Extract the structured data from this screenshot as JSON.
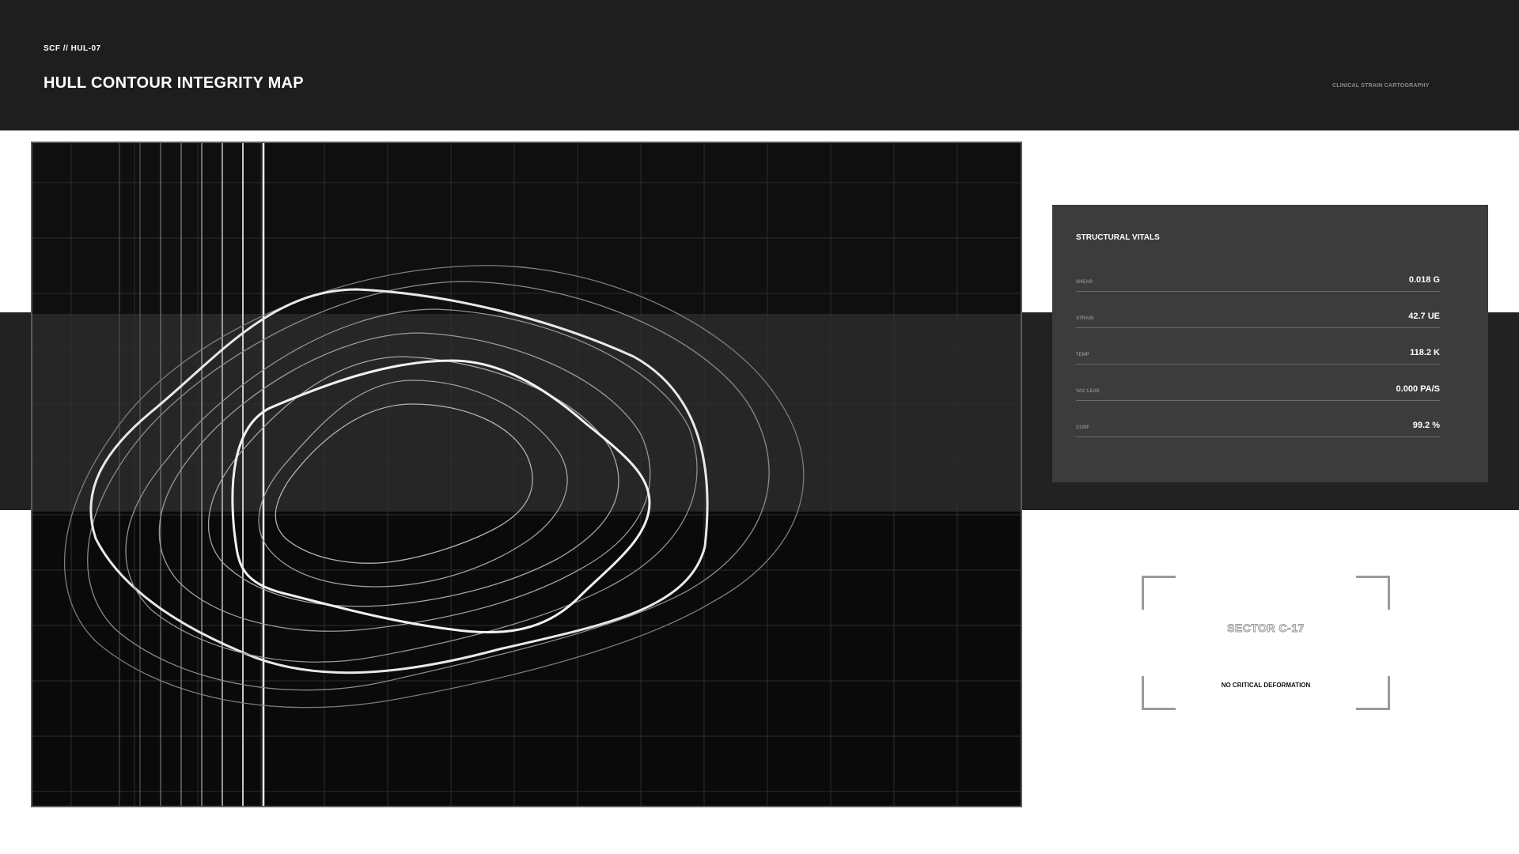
{
  "header": {
    "code": "SCF // HUL-07",
    "title": "HULL CONTOUR INTEGRITY MAP",
    "tag": "CLINICAL STRAIN CARTOGRAPHY"
  },
  "vitals": {
    "title": "STRUCTURAL VITALS",
    "rows": [
      {
        "label": "SHEAR",
        "value": "0.018 G"
      },
      {
        "label": "STRAIN",
        "value": "42.7 UE"
      },
      {
        "label": "TEMP",
        "value": "118.2 K"
      },
      {
        "label": "VAC LEAK",
        "value": "0.000 PA/S"
      },
      {
        "label": "CONF",
        "value": "99.2 %"
      }
    ]
  },
  "sector": {
    "name": "SECTOR C-17",
    "status": "NO CRITICAL DEFORMATION"
  }
}
